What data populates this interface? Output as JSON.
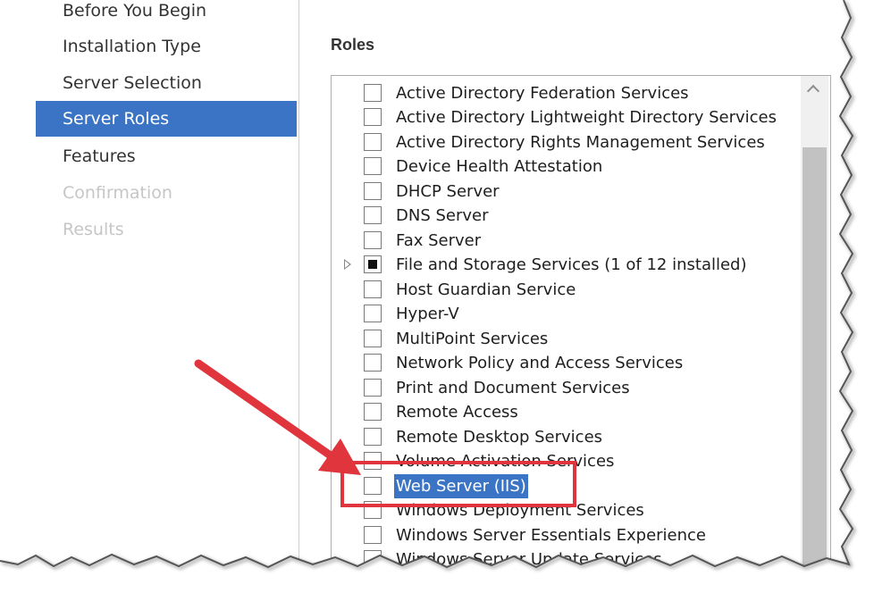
{
  "nav": {
    "items": [
      {
        "label": "Before You Begin",
        "state": "normal"
      },
      {
        "label": "Installation Type",
        "state": "normal"
      },
      {
        "label": "Server Selection",
        "state": "normal"
      },
      {
        "label": "Server Roles",
        "state": "active"
      },
      {
        "label": "Features",
        "state": "normal"
      },
      {
        "label": "Confirmation",
        "state": "disabled"
      },
      {
        "label": "Results",
        "state": "disabled"
      }
    ]
  },
  "roles": {
    "title": "Roles",
    "items": [
      {
        "label": "Active Directory Federation Services",
        "checked": false
      },
      {
        "label": "Active Directory Lightweight Directory Services",
        "checked": false
      },
      {
        "label": "Active Directory Rights Management Services",
        "checked": false
      },
      {
        "label": "Device Health Attestation",
        "checked": false
      },
      {
        "label": "DHCP Server",
        "checked": false
      },
      {
        "label": "DNS Server",
        "checked": false
      },
      {
        "label": "Fax Server",
        "checked": false
      },
      {
        "label": "File and Storage Services (1 of 12 installed)",
        "checked": "partial",
        "expandable": true
      },
      {
        "label": "Host Guardian Service",
        "checked": false
      },
      {
        "label": "Hyper-V",
        "checked": false
      },
      {
        "label": "MultiPoint Services",
        "checked": false
      },
      {
        "label": "Network Policy and Access Services",
        "checked": false
      },
      {
        "label": "Print and Document Services",
        "checked": false
      },
      {
        "label": "Remote Access",
        "checked": false
      },
      {
        "label": "Remote Desktop Services",
        "checked": false
      },
      {
        "label": "Volume Activation Services",
        "checked": false
      },
      {
        "label": "Web Server (IIS)",
        "checked": false,
        "selected": true
      },
      {
        "label": "Windows Deployment Services",
        "checked": false
      },
      {
        "label": "Windows Server Essentials Experience",
        "checked": false
      },
      {
        "label": "Windows Server Update Services",
        "checked": false
      }
    ]
  },
  "colors": {
    "selection": "#3b74c4",
    "annotation": "#e0353d"
  },
  "annotation": {
    "icon": "red-arrow-icon",
    "target": "Web Server (IIS)"
  }
}
